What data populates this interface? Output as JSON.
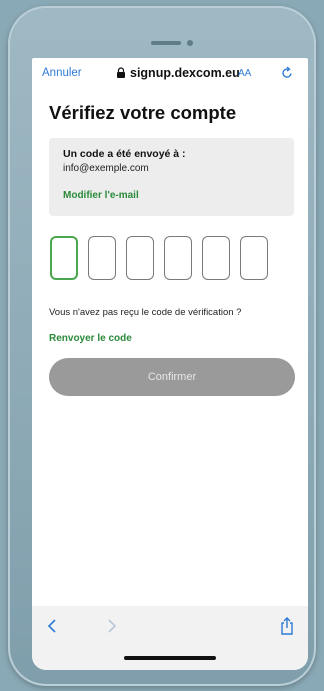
{
  "browser": {
    "cancel_label": "Annuler",
    "domain": "signup.dexcom.eu",
    "text_size_label": "AA",
    "accent_color": "#2f7bd6"
  },
  "page": {
    "title": "Vérifiez votre compte",
    "info": {
      "label": "Un code a été envoyé à :",
      "email": "info@exemple.com",
      "modify_link": "Modifier l'e-mail"
    },
    "code_fields": [
      {
        "value": "",
        "active": true
      },
      {
        "value": "",
        "active": false
      },
      {
        "value": "",
        "active": false
      },
      {
        "value": "",
        "active": false
      },
      {
        "value": "",
        "active": false
      },
      {
        "value": "",
        "active": false
      }
    ],
    "no_code_text": "Vous n'avez pas reçu le code de vérification ?",
    "resend_link": "Renvoyer le code",
    "confirm_label": "Confirmer",
    "link_color": "#2a8a3a",
    "button_color": "#9a9a9a"
  },
  "toolbar": {
    "icons": [
      "chevron-left-icon",
      "chevron-right-icon",
      "share-icon"
    ]
  }
}
